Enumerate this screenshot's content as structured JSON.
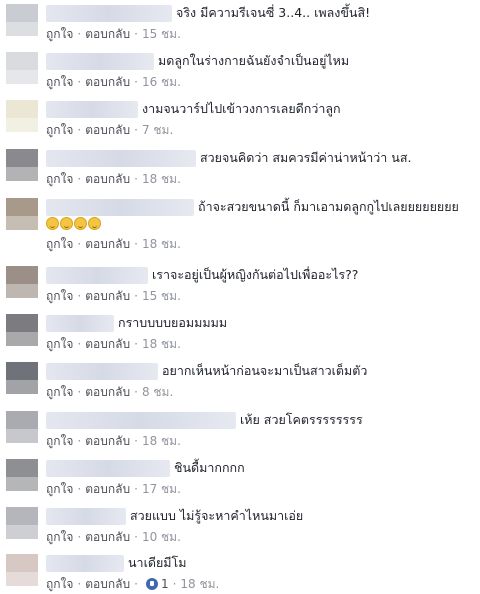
{
  "common": {
    "like_label": "ถูกใจ",
    "reply_label": "ตอบกลับ",
    "dot": "·"
  },
  "comments": [
    {
      "text": "จริง มีความรีเจนซี่ 3..4.. เพลงขึ้นสิ!",
      "time": "15 ชม."
    },
    {
      "text": "มดลูกในร่างกายฉันยังจำเป็นอยู่ไหม",
      "time": "16 ชม."
    },
    {
      "text": "งามจนวาร์ปไปเข้าวงการเลยดีกว่าลูก",
      "time": "7 ชม."
    },
    {
      "text": "สวยจนคิดว่า สมควรมีค่าน่าหน้าว่า นส.",
      "time": "18 ชม."
    },
    {
      "text": "ถ้าจะสวยขนาดนี้ ก็มาเอามดลูกกูไปเลยยยยยยยย",
      "time": "18 ชม."
    },
    {
      "text": "เราจะอยู่เป็นผู้หญิงกันต่อไปเพื่ออะไร??",
      "time": "15 ชม."
    },
    {
      "text": "กราบบบบยอมมมมม",
      "time": "18 ชม."
    },
    {
      "text": "อยากเห็นหน้าก่อนจะมาเป็นสาวเต็มตัว",
      "time": "8 ชม."
    },
    {
      "text": "เห้ย สวยโคตรรรรรรรร",
      "time": "18 ชม."
    },
    {
      "text": "ชินดื้มากกกก",
      "time": "17 ชม."
    },
    {
      "text": "สวยแบบ ไม่รู้จะหาคำไหนมาเอ่ย",
      "time": "10 ชม."
    },
    {
      "text": "นาเดียมีโม",
      "time": "18 ชม.",
      "likes": "1"
    }
  ]
}
